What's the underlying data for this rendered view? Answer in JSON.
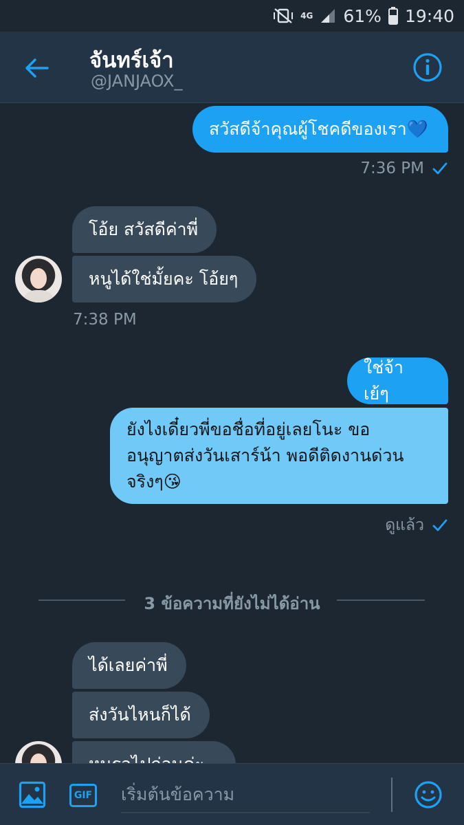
{
  "status_bar": {
    "network": "4G",
    "battery": "61%",
    "time": "19:40"
  },
  "header": {
    "name": "จันทร์เจ้า",
    "handle": "@JANJAOX_"
  },
  "messages": {
    "m1": {
      "text": "สวัสดีจ้าคุณผู้โชคดีของเรา💙",
      "time": "7:36 PM"
    },
    "m2": {
      "text": "โอ้ย สวัสดีค่าพี่"
    },
    "m3": {
      "text": "หนูได้ใช่มั้ยคะ โอ้ยๆ",
      "time": "7:38 PM"
    },
    "m4": {
      "text": "ใช่จ้า เย้ๆ"
    },
    "m5": {
      "line1": "ยังไงเดี๋ยวพี่ขอชื่อที่อยู่เลยโนะ ขอ",
      "line2": "อนุญาตส่งวันเสาร์น้า พอดีติดงานด่วน",
      "line3": "จริงๆ😘",
      "status": "ดูแล้ว"
    },
    "unread_divider": "3 ข้อความที่ยังไม่ได้อ่าน",
    "m6": {
      "text": "ได้เลยค่าพี่"
    },
    "m7": {
      "text": "ส่งวันไหนก็ได้"
    },
    "m8": {
      "text": "หนูรอไปก่อนค่ะ"
    }
  },
  "composer": {
    "placeholder": "เริ่มต้นข้อความ",
    "gif_label": "GIF"
  },
  "colors": {
    "accent": "#1da1f2",
    "background": "#1c2732",
    "header": "#243447",
    "incoming_bubble": "#38495a",
    "read_bubble": "#71c9f8"
  }
}
